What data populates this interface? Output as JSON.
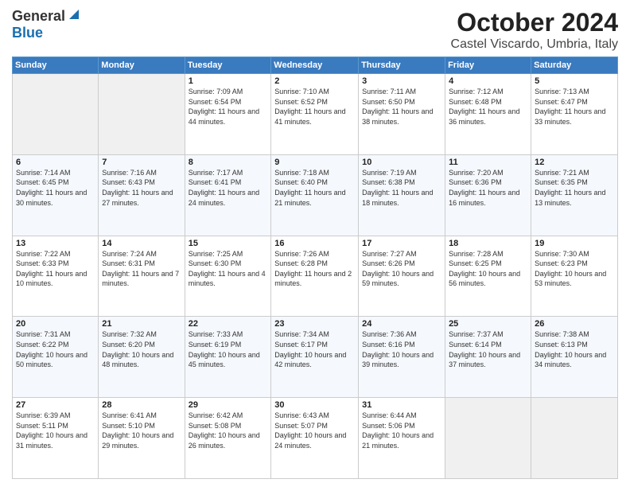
{
  "logo": {
    "general": "General",
    "blue": "Blue"
  },
  "title": "October 2024",
  "location": "Castel Viscardo, Umbria, Italy",
  "days_of_week": [
    "Sunday",
    "Monday",
    "Tuesday",
    "Wednesday",
    "Thursday",
    "Friday",
    "Saturday"
  ],
  "weeks": [
    [
      {
        "day": "",
        "info": ""
      },
      {
        "day": "",
        "info": ""
      },
      {
        "day": "1",
        "info": "Sunrise: 7:09 AM\nSunset: 6:54 PM\nDaylight: 11 hours and 44 minutes."
      },
      {
        "day": "2",
        "info": "Sunrise: 7:10 AM\nSunset: 6:52 PM\nDaylight: 11 hours and 41 minutes."
      },
      {
        "day": "3",
        "info": "Sunrise: 7:11 AM\nSunset: 6:50 PM\nDaylight: 11 hours and 38 minutes."
      },
      {
        "day": "4",
        "info": "Sunrise: 7:12 AM\nSunset: 6:48 PM\nDaylight: 11 hours and 36 minutes."
      },
      {
        "day": "5",
        "info": "Sunrise: 7:13 AM\nSunset: 6:47 PM\nDaylight: 11 hours and 33 minutes."
      }
    ],
    [
      {
        "day": "6",
        "info": "Sunrise: 7:14 AM\nSunset: 6:45 PM\nDaylight: 11 hours and 30 minutes."
      },
      {
        "day": "7",
        "info": "Sunrise: 7:16 AM\nSunset: 6:43 PM\nDaylight: 11 hours and 27 minutes."
      },
      {
        "day": "8",
        "info": "Sunrise: 7:17 AM\nSunset: 6:41 PM\nDaylight: 11 hours and 24 minutes."
      },
      {
        "day": "9",
        "info": "Sunrise: 7:18 AM\nSunset: 6:40 PM\nDaylight: 11 hours and 21 minutes."
      },
      {
        "day": "10",
        "info": "Sunrise: 7:19 AM\nSunset: 6:38 PM\nDaylight: 11 hours and 18 minutes."
      },
      {
        "day": "11",
        "info": "Sunrise: 7:20 AM\nSunset: 6:36 PM\nDaylight: 11 hours and 16 minutes."
      },
      {
        "day": "12",
        "info": "Sunrise: 7:21 AM\nSunset: 6:35 PM\nDaylight: 11 hours and 13 minutes."
      }
    ],
    [
      {
        "day": "13",
        "info": "Sunrise: 7:22 AM\nSunset: 6:33 PM\nDaylight: 11 hours and 10 minutes."
      },
      {
        "day": "14",
        "info": "Sunrise: 7:24 AM\nSunset: 6:31 PM\nDaylight: 11 hours and 7 minutes."
      },
      {
        "day": "15",
        "info": "Sunrise: 7:25 AM\nSunset: 6:30 PM\nDaylight: 11 hours and 4 minutes."
      },
      {
        "day": "16",
        "info": "Sunrise: 7:26 AM\nSunset: 6:28 PM\nDaylight: 11 hours and 2 minutes."
      },
      {
        "day": "17",
        "info": "Sunrise: 7:27 AM\nSunset: 6:26 PM\nDaylight: 10 hours and 59 minutes."
      },
      {
        "day": "18",
        "info": "Sunrise: 7:28 AM\nSunset: 6:25 PM\nDaylight: 10 hours and 56 minutes."
      },
      {
        "day": "19",
        "info": "Sunrise: 7:30 AM\nSunset: 6:23 PM\nDaylight: 10 hours and 53 minutes."
      }
    ],
    [
      {
        "day": "20",
        "info": "Sunrise: 7:31 AM\nSunset: 6:22 PM\nDaylight: 10 hours and 50 minutes."
      },
      {
        "day": "21",
        "info": "Sunrise: 7:32 AM\nSunset: 6:20 PM\nDaylight: 10 hours and 48 minutes."
      },
      {
        "day": "22",
        "info": "Sunrise: 7:33 AM\nSunset: 6:19 PM\nDaylight: 10 hours and 45 minutes."
      },
      {
        "day": "23",
        "info": "Sunrise: 7:34 AM\nSunset: 6:17 PM\nDaylight: 10 hours and 42 minutes."
      },
      {
        "day": "24",
        "info": "Sunrise: 7:36 AM\nSunset: 6:16 PM\nDaylight: 10 hours and 39 minutes."
      },
      {
        "day": "25",
        "info": "Sunrise: 7:37 AM\nSunset: 6:14 PM\nDaylight: 10 hours and 37 minutes."
      },
      {
        "day": "26",
        "info": "Sunrise: 7:38 AM\nSunset: 6:13 PM\nDaylight: 10 hours and 34 minutes."
      }
    ],
    [
      {
        "day": "27",
        "info": "Sunrise: 6:39 AM\nSunset: 5:11 PM\nDaylight: 10 hours and 31 minutes."
      },
      {
        "day": "28",
        "info": "Sunrise: 6:41 AM\nSunset: 5:10 PM\nDaylight: 10 hours and 29 minutes."
      },
      {
        "day": "29",
        "info": "Sunrise: 6:42 AM\nSunset: 5:08 PM\nDaylight: 10 hours and 26 minutes."
      },
      {
        "day": "30",
        "info": "Sunrise: 6:43 AM\nSunset: 5:07 PM\nDaylight: 10 hours and 24 minutes."
      },
      {
        "day": "31",
        "info": "Sunrise: 6:44 AM\nSunset: 5:06 PM\nDaylight: 10 hours and 21 minutes."
      },
      {
        "day": "",
        "info": ""
      },
      {
        "day": "",
        "info": ""
      }
    ]
  ]
}
